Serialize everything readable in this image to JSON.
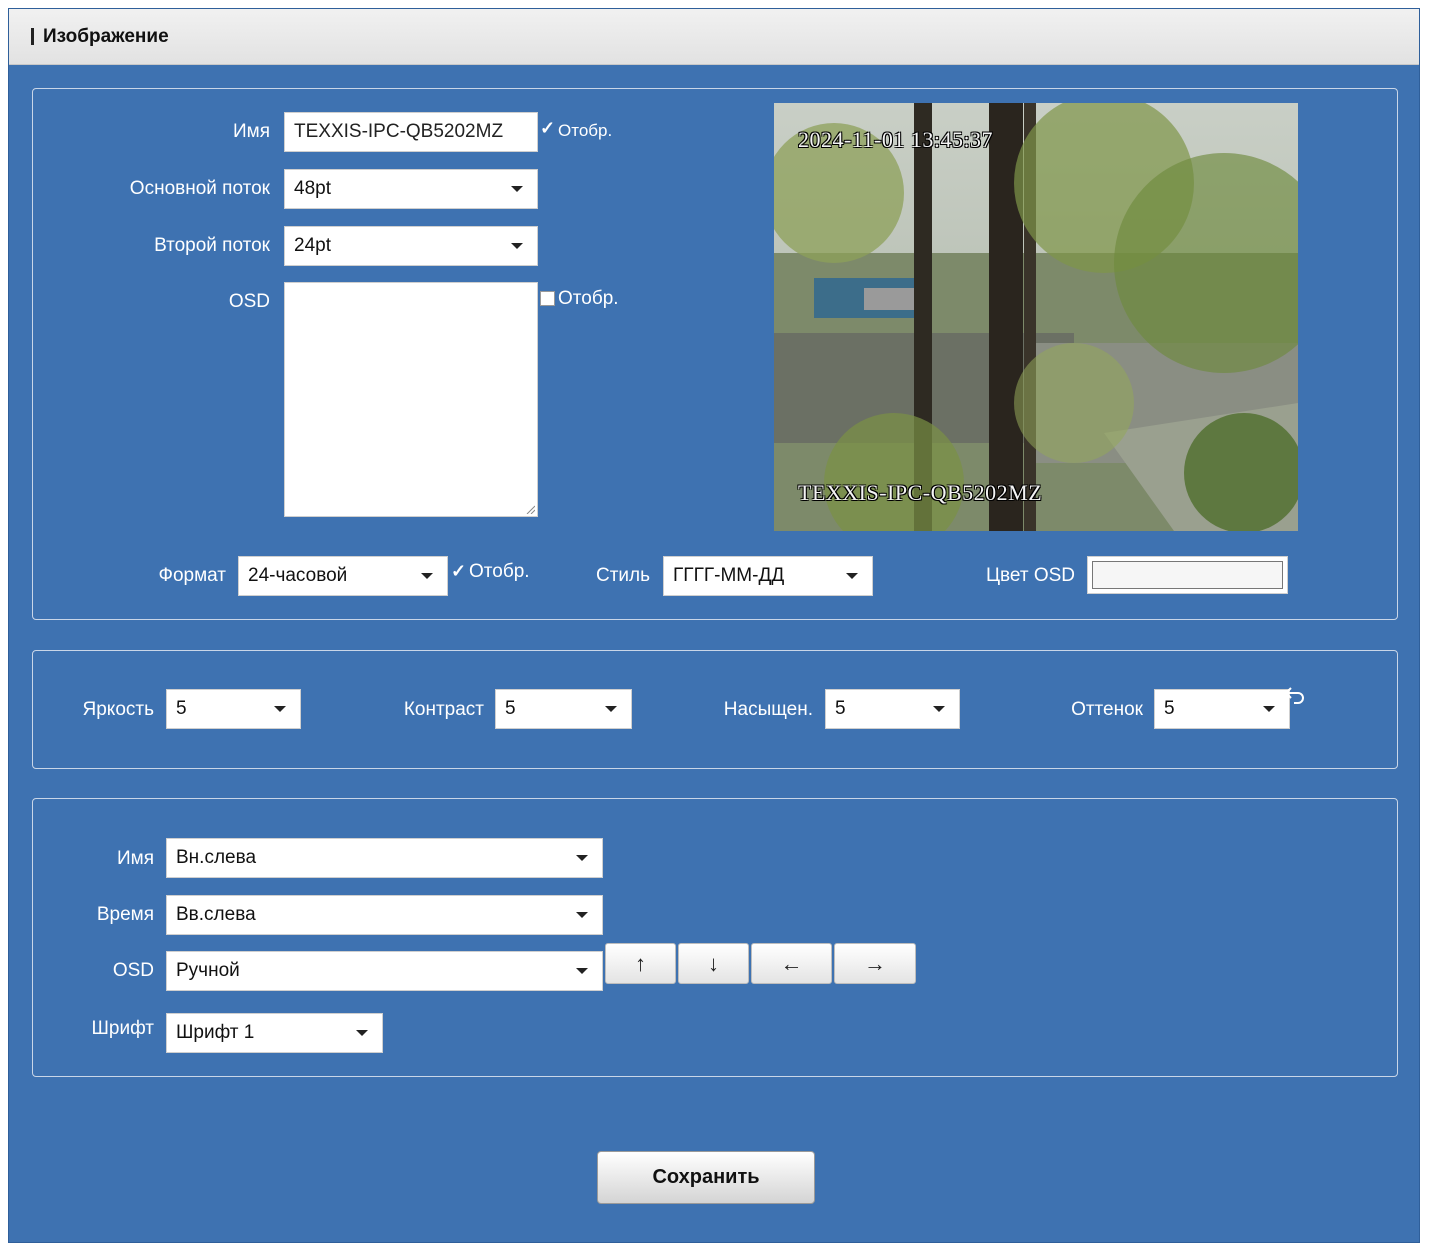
{
  "header": {
    "title": "Изображение"
  },
  "section_osd": {
    "name_label": "Имя",
    "name_value": "TEXXIS-IPC-QB5202MZ",
    "name_show_label": "Отобр.",
    "name_show_checked": true,
    "main_stream_label": "Основной поток",
    "main_stream_value": "48pt",
    "sub_stream_label": "Второй поток",
    "sub_stream_value": "24pt",
    "osd_label": "OSD",
    "osd_text": "",
    "osd_show_label": "Отобр.",
    "osd_show_checked": false,
    "format_label": "Формат",
    "format_value": "24-часовой",
    "format_show_label": "Отобр.",
    "format_show_checked": true,
    "style_label": "Стиль",
    "style_value": "ГГГГ-ММ-ДД",
    "osd_color_label": "Цвет OSD"
  },
  "preview": {
    "timestamp": "2024-11-01 13:45:37",
    "camera_name": "TEXXIS-IPC-QB5202MZ"
  },
  "section_image": {
    "brightness_label": "Яркость",
    "brightness_value": "5",
    "contrast_label": "Контраст",
    "contrast_value": "5",
    "saturation_label": "Насыщен.",
    "saturation_value": "5",
    "hue_label": "Оттенок",
    "hue_value": "5"
  },
  "section_position": {
    "name_label": "Имя",
    "name_value": "Вн.слева",
    "time_label": "Время",
    "time_value": "Вв.слева",
    "osd_label": "OSD",
    "osd_value": "Ручной",
    "font_label": "Шрифт",
    "font_value": "Шрифт 1",
    "arrow_up": "↑",
    "arrow_down": "↓",
    "arrow_left": "←",
    "arrow_right": "→"
  },
  "actions": {
    "save_label": "Сохранить"
  },
  "colors": {
    "panel_bg": "#3e72b1",
    "header_bg": "#e8e8e8",
    "check": "#2d7de0"
  }
}
